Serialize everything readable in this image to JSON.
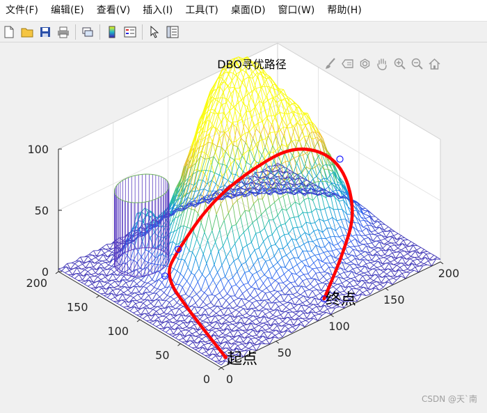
{
  "menubar": {
    "items": [
      "文件(F)",
      "编辑(E)",
      "查看(V)",
      "插入(I)",
      "工具(T)",
      "桌面(D)",
      "窗口(W)",
      "帮助(H)"
    ]
  },
  "toolbar": {
    "icons": [
      "new-file-icon",
      "open-folder-icon",
      "save-icon",
      "print-icon",
      "link-plot-icon",
      "colorbar-icon",
      "legend-icon",
      "pointer-icon",
      "property-inspector-icon"
    ]
  },
  "axes_toolbar": {
    "icons": [
      "brush-icon",
      "data-tips-icon",
      "rotate-3d-icon",
      "pan-hand-icon",
      "zoom-in-icon",
      "zoom-out-icon",
      "home-icon"
    ]
  },
  "plot": {
    "title": "DBO寻优路径",
    "z_ticks": [
      "0",
      "50",
      "100"
    ],
    "y_ticks": [
      "0",
      "50",
      "100",
      "150",
      "200"
    ],
    "x_ticks": [
      "0",
      "50",
      "100",
      "150",
      "200"
    ],
    "start_label": "起点",
    "end_label": "终点"
  },
  "colors": {
    "path": "#ff0000",
    "waypoint": "#1a1aff",
    "surface_low": "#3f1ab5",
    "surface_high": "#f9fb0e"
  },
  "watermark": "CSDN @天`南"
}
